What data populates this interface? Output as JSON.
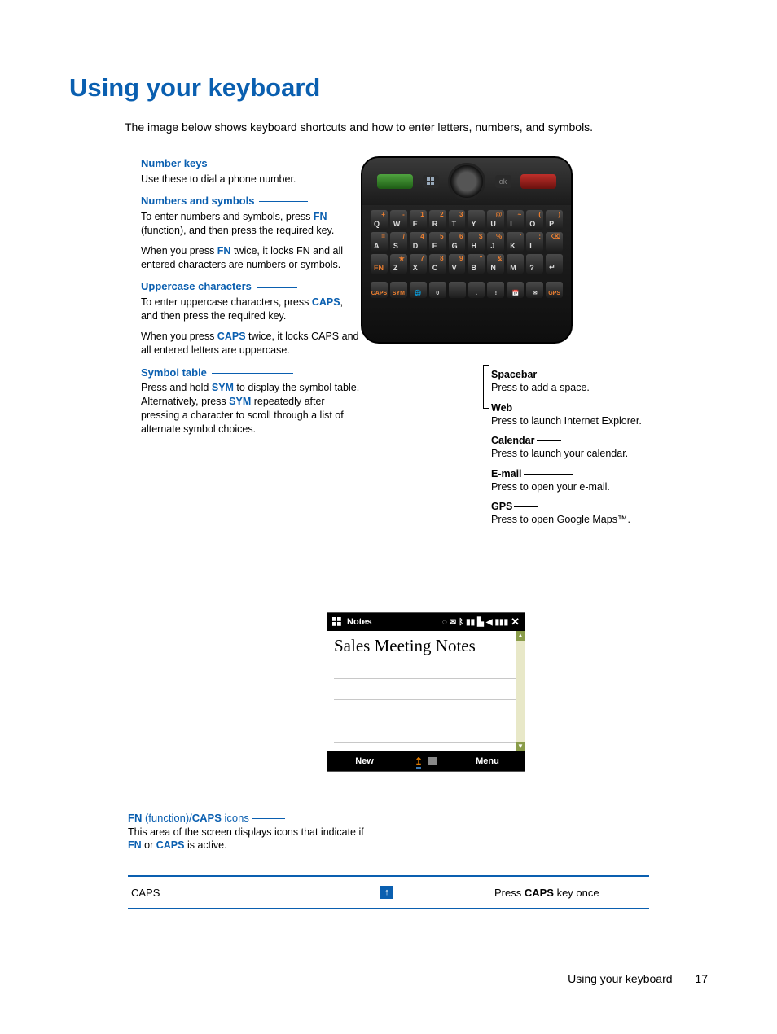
{
  "heading": "Using your keyboard",
  "intro": "The image below shows keyboard shortcuts and how to enter letters, numbers, and symbols.",
  "left_callouts": {
    "number_keys": {
      "title": "Number keys",
      "body": "Use these to dial a phone number."
    },
    "numbers_symbols": {
      "title": "Numbers and symbols",
      "body1_a": "To enter numbers and symbols, press ",
      "body1_fn": "FN",
      "body1_b": " (function), and then press the required key.",
      "body2_a": "When you press ",
      "body2_fn": "FN",
      "body2_b": " twice, it locks FN and all entered characters are numbers or symbols."
    },
    "uppercase": {
      "title": "Uppercase characters",
      "body1_a": "To enter uppercase characters, press ",
      "body1_caps": "CAPS",
      "body1_b": ", and then press the required key.",
      "body2_a": "When you press ",
      "body2_caps": "CAPS",
      "body2_b": " twice, it locks CAPS and all entered letters are uppercase."
    },
    "symbol_table": {
      "title": "Symbol table",
      "body_a": "Press and hold ",
      "body_sym1": "SYM",
      "body_b": " to display the symbol table. Alternatively, press ",
      "body_sym2": "SYM",
      "body_c": " repeatedly after pressing a character to scroll through a list of alternate symbol choices."
    }
  },
  "right_callouts": {
    "spacebar": {
      "title": "Spacebar",
      "body": "Press to add a space."
    },
    "web": {
      "title": "Web",
      "body": "Press to launch Internet Explorer."
    },
    "calendar": {
      "title": "Calendar",
      "body": "Press to launch your calendar."
    },
    "email": {
      "title": "E-mail",
      "body": "Press to open your e-mail."
    },
    "gps": {
      "title": "GPS",
      "body": "Press to open Google Maps™."
    }
  },
  "phone_keys": {
    "row1": [
      {
        "n": "+",
        "l": "Q"
      },
      {
        "n": "-",
        "l": "W"
      },
      {
        "n": "1",
        "l": "E"
      },
      {
        "n": "2",
        "l": "R"
      },
      {
        "n": "3",
        "l": "T"
      },
      {
        "n": "_",
        "l": "Y"
      },
      {
        "n": "@",
        "l": "U"
      },
      {
        "n": "~",
        "l": "I"
      },
      {
        "n": "(",
        "l": "O"
      },
      {
        "n": ")",
        "l": "P"
      }
    ],
    "row2": [
      {
        "n": "=",
        "l": "A"
      },
      {
        "n": "/",
        "l": "S"
      },
      {
        "n": "4",
        "l": "D"
      },
      {
        "n": "5",
        "l": "F"
      },
      {
        "n": "6",
        "l": "G"
      },
      {
        "n": "$",
        "l": "H"
      },
      {
        "n": "%",
        "l": "J"
      },
      {
        "n": "'",
        "l": "K"
      },
      {
        "n": ":",
        "l": "L"
      },
      {
        "n": "⌫",
        "l": ""
      }
    ],
    "row3": [
      {
        "n": "",
        "l": "FN"
      },
      {
        "n": "★",
        "l": "Z"
      },
      {
        "n": "7",
        "l": "X"
      },
      {
        "n": "8",
        "l": "C"
      },
      {
        "n": "9",
        "l": "V"
      },
      {
        "n": "\"",
        "l": "B"
      },
      {
        "n": "&",
        "l": "N"
      },
      {
        "n": "",
        "l": "M"
      },
      {
        "n": "",
        "l": "?"
      },
      {
        "n": "",
        "l": "↵"
      }
    ],
    "row4_labels": {
      "caps": "CAPS",
      "sym": "SYM",
      "zero": "0",
      "dot": ".",
      "excl": "!",
      "cal": "📅",
      "mail": "✉",
      "gps": "GPS"
    }
  },
  "notes": {
    "app_title": "Notes",
    "doc_title": "Sales Meeting Notes",
    "softkey_left": "New",
    "softkey_right": "Menu"
  },
  "below_callout": {
    "title_a": "FN",
    "title_mid": " (function)/",
    "title_b": "CAPS",
    "title_end": " icons",
    "body_a": "This area of the screen displays icons that indicate if ",
    "body_fn": "FN",
    "body_mid": " or ",
    "body_caps": "CAPS",
    "body_end": " is active."
  },
  "caps_row": {
    "label": "CAPS",
    "glyph": "↑",
    "desc_a": "Press ",
    "desc_caps": "CAPS",
    "desc_b": " key once"
  },
  "footer": {
    "section": "Using your keyboard",
    "page": "17"
  }
}
